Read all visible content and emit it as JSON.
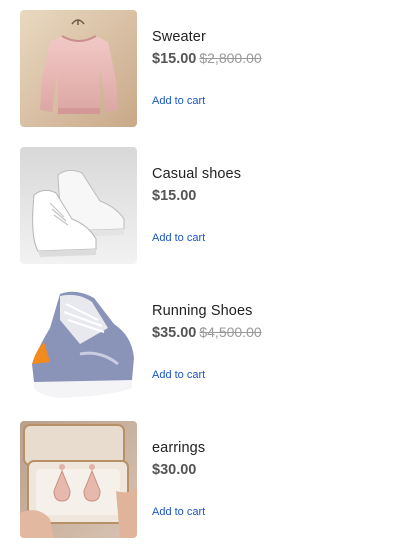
{
  "products": [
    {
      "name": "Sweater",
      "price": "$15.00",
      "old_price": "$2,800.00",
      "cart_label": "Add to cart",
      "image_icon": "pink-sweater-image"
    },
    {
      "name": "Casual shoes",
      "price": "$15.00",
      "old_price": "",
      "cart_label": "Add to cart",
      "image_icon": "white-sneakers-image"
    },
    {
      "name": "Running Shoes",
      "price": "$35.00",
      "old_price": "$4,500.00",
      "cart_label": "Add to cart",
      "image_icon": "running-shoe-image"
    },
    {
      "name": "earrings",
      "price": "$30.00",
      "old_price": "",
      "cart_label": "Add to cart",
      "image_icon": "earrings-box-image"
    }
  ],
  "colors": {
    "link": "#1a56c4",
    "price": "#555555",
    "old_price": "#999999",
    "name": "#222222"
  }
}
